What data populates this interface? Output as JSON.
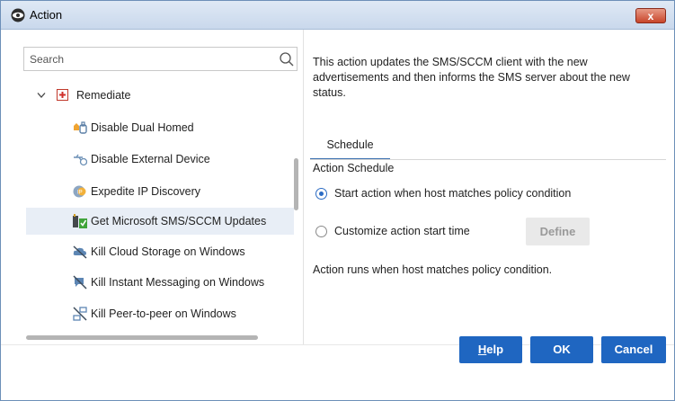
{
  "window": {
    "title": "Action",
    "close_label": "x"
  },
  "search": {
    "placeholder": "Search"
  },
  "tree": {
    "group_label": "Remediate",
    "items": [
      {
        "label": "Disable Dual Homed",
        "icon": "dual-homed-icon"
      },
      {
        "label": "Disable External Device",
        "icon": "usb-device-icon"
      },
      {
        "label": "Expedite IP Discovery",
        "icon": "ip-discovery-icon"
      },
      {
        "label": "Get Microsoft SMS/SCCM Updates",
        "icon": "sccm-updates-icon",
        "selected": true
      },
      {
        "label": "Kill Cloud Storage on Windows",
        "icon": "cloud-storage-icon"
      },
      {
        "label": "Kill Instant Messaging on Windows",
        "icon": "instant-messaging-icon"
      },
      {
        "label": "Kill Peer-to-peer on Windows",
        "icon": "peer-to-peer-icon"
      }
    ]
  },
  "detail": {
    "description": "This action updates the SMS/SCCM client with the new advertisements and then informs the SMS server about the new status.",
    "tab_label": "Schedule",
    "section_label": "Action Schedule",
    "option_start": "Start action when host matches policy condition",
    "option_custom": "Customize action start time",
    "define_label": "Define",
    "note": "Action runs when host matches policy condition."
  },
  "buttons": {
    "help_u": "H",
    "help_rest": "elp",
    "ok": "OK",
    "cancel": "Cancel"
  },
  "colors": {
    "accent": "#1f66c1",
    "selected_row": "#e8eef6",
    "close": "#c8452b"
  }
}
